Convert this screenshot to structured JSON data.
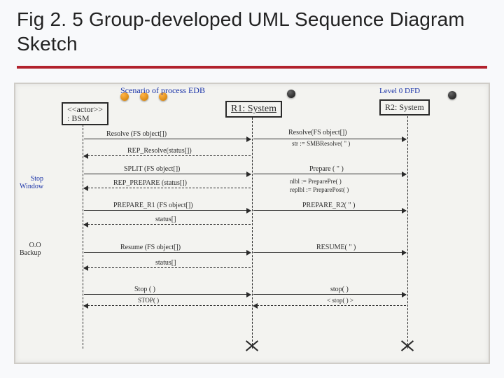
{
  "slide": {
    "title": "Fig 2. 5 Group-developed UML Sequence Diagram Sketch"
  },
  "whiteboard": {
    "heading_left": "Scenario   of  process   EDB",
    "heading_right": "Level 0 DFD",
    "lifelines": {
      "actor": "<<actor>>\n: BSM",
      "r1": "R1: System",
      "r2": "R2: System"
    },
    "side_notes": {
      "stop_window": "Stop\nWindow",
      "backup": "O.O\nBackup"
    },
    "messages": {
      "m1": "Resolve (FS object[])",
      "m2": "Resolve(FS object[])",
      "m2b": "str := SMBResolve(  \"  )",
      "m3": "REP_Resolve(status[])",
      "m4": "SPLIT  (FS object[])",
      "m4r": "Prepare (  \" )",
      "m5": "REP_PREPARE (status[])",
      "m5r1": "nlbl := PreparePre( )",
      "m5r2": "replbl := PreparePost( )",
      "m6": "PREPARE_R1   (FS object[])",
      "m6r": "PREPARE_R2(  \"  )",
      "m7": "status[]",
      "m8": "Resume   (FS object[])",
      "m8r": "RESUME(  \"  )",
      "m9": "status[]",
      "m10": "Stop ( )",
      "m10b": "STOP( )",
      "m10r1": "stop( )",
      "m10r2": "< stop( ) >"
    }
  }
}
